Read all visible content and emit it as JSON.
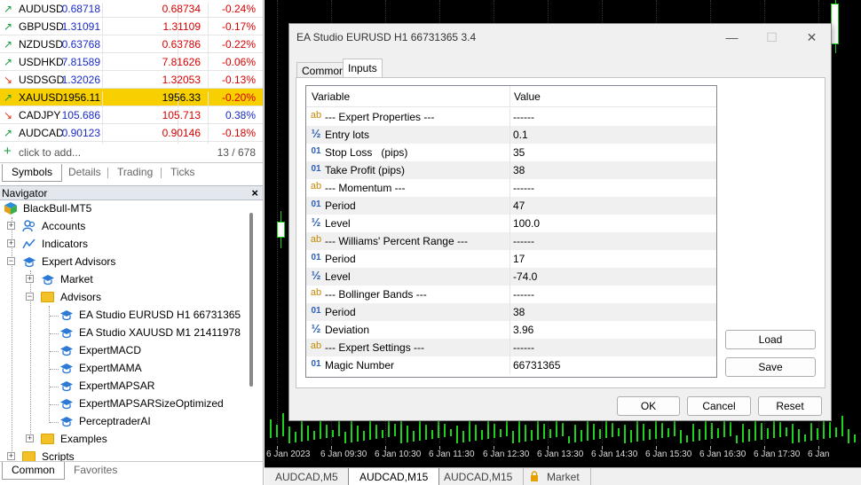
{
  "market_watch": {
    "rows": [
      {
        "symbol": "AUDUSD",
        "bid": "0.68718",
        "ask": "0.68734",
        "change": "-0.24%",
        "dir": "up",
        "highlight": false
      },
      {
        "symbol": "GBPUSD",
        "bid": "1.31091",
        "ask": "1.31109",
        "change": "-0.17%",
        "dir": "up",
        "highlight": false
      },
      {
        "symbol": "NZDUSD",
        "bid": "0.63768",
        "ask": "0.63786",
        "change": "-0.22%",
        "dir": "up",
        "highlight": false
      },
      {
        "symbol": "USDHKD",
        "bid": "7.81589",
        "ask": "7.81626",
        "change": "-0.06%",
        "dir": "up",
        "highlight": false
      },
      {
        "symbol": "USDSGD",
        "bid": "1.32026",
        "ask": "1.32053",
        "change": "-0.13%",
        "dir": "down",
        "highlight": false
      },
      {
        "symbol": "XAUUSD",
        "bid": "1956.11",
        "ask": "1956.33",
        "change": "-0.20%",
        "dir": "up",
        "highlight": true
      },
      {
        "symbol": "CADJPY",
        "bid": "105.686",
        "ask": "105.713",
        "change": "0.38%",
        "dir": "down",
        "highlight": false
      },
      {
        "symbol": "AUDCAD",
        "bid": "0.90123",
        "ask": "0.90146",
        "change": "-0.18%",
        "dir": "up",
        "highlight": false
      }
    ],
    "add_placeholder": "click to add...",
    "count": "13 / 678",
    "tabs": [
      "Symbols",
      "Details",
      "Trading",
      "Ticks"
    ]
  },
  "navigator": {
    "title": "Navigator",
    "close": "×",
    "root": "BlackBull-MT5",
    "accounts": "Accounts",
    "indicators": "Indicators",
    "expert_advisors": "Expert Advisors",
    "market": "Market",
    "advisors": "Advisors",
    "advisor_items": [
      "EA Studio EURUSD H1 66731365",
      "EA Studio XAUUSD M1 21411978",
      "ExpertMACD",
      "ExpertMAMA",
      "ExpertMAPSAR",
      "ExpertMAPSARSizeOptimized",
      "PerceptraderAI"
    ],
    "examples": "Examples",
    "scripts": "Scripts",
    "tabs": [
      "Common",
      "Favorites"
    ]
  },
  "chart": {
    "time_labels": [
      "6 Jan 2023",
      "6 Jan 09:30",
      "6 Jan 10:30",
      "6 Jan 11:30",
      "6 Jan 12:30",
      "6 Jan 13:30",
      "6 Jan 14:30",
      "6 Jan 15:30",
      "6 Jan 16:30",
      "6 Jan 17:30",
      "6 Jan"
    ],
    "tabs": [
      "AUDCAD,M5",
      "AUDCAD,M15",
      "AUDCAD,M15",
      "Market"
    ],
    "active_tab": 1
  },
  "dialog": {
    "title": "EA Studio EURUSD H1 66731365 3.4",
    "minimize": "—",
    "maximize": "☐",
    "close": "✕",
    "tabs": [
      "Common",
      "Inputs"
    ],
    "active_tab": 1,
    "columns": {
      "variable": "Variable",
      "value": "Value"
    },
    "params": [
      {
        "icon": "ab",
        "name": "--- Expert Properties ---",
        "value": "------"
      },
      {
        "icon": "half",
        "name": "Entry lots",
        "value": "0.1"
      },
      {
        "icon": "01",
        "name": "Stop Loss   (pips)",
        "value": "35"
      },
      {
        "icon": "01",
        "name": "Take Profit (pips)",
        "value": "38"
      },
      {
        "icon": "ab",
        "name": "--- Momentum ---",
        "value": "------"
      },
      {
        "icon": "01",
        "name": "Period",
        "value": "47"
      },
      {
        "icon": "half",
        "name": "Level",
        "value": "100.0"
      },
      {
        "icon": "ab",
        "name": "--- Williams' Percent Range ---",
        "value": "------"
      },
      {
        "icon": "01",
        "name": "Period",
        "value": "17"
      },
      {
        "icon": "half",
        "name": "Level",
        "value": "-74.0"
      },
      {
        "icon": "ab",
        "name": "--- Bollinger Bands ---",
        "value": "------"
      },
      {
        "icon": "01",
        "name": "Period",
        "value": "38"
      },
      {
        "icon": "half",
        "name": "Deviation",
        "value": "3.96"
      },
      {
        "icon": "ab",
        "name": "--- Expert Settings ---",
        "value": "------"
      },
      {
        "icon": "01",
        "name": "Magic Number",
        "value": "66731365"
      }
    ],
    "buttons": {
      "load": "Load",
      "save": "Save",
      "ok": "OK",
      "cancel": "Cancel",
      "reset": "Reset"
    }
  }
}
